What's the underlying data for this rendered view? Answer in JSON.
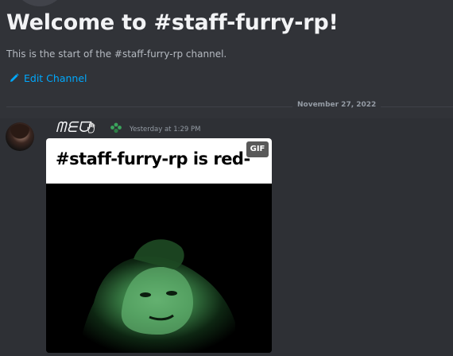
{
  "channel": {
    "welcome_title": "Welcome to #staff-furry-rp!",
    "welcome_subtitle": "This is the start of the #staff-furry-rp channel.",
    "edit_channel_label": "Edit Channel",
    "edit_icon": "pencil-icon"
  },
  "divider": {
    "date": "November 27, 2022"
  },
  "message": {
    "username": "ᗰᗴᗜ",
    "username_icon": "hand-emoji-icon",
    "role_icon": "leaf-role-icon",
    "timestamp": "Yesterday at 1:29 PM",
    "gif": {
      "caption": "#staff-furry-rp is red-",
      "badge": "GIF"
    }
  },
  "colors": {
    "background": "#313338",
    "message_hover": "#2e3035",
    "link": "#00a8fc",
    "role_green": "#3ba55c"
  }
}
